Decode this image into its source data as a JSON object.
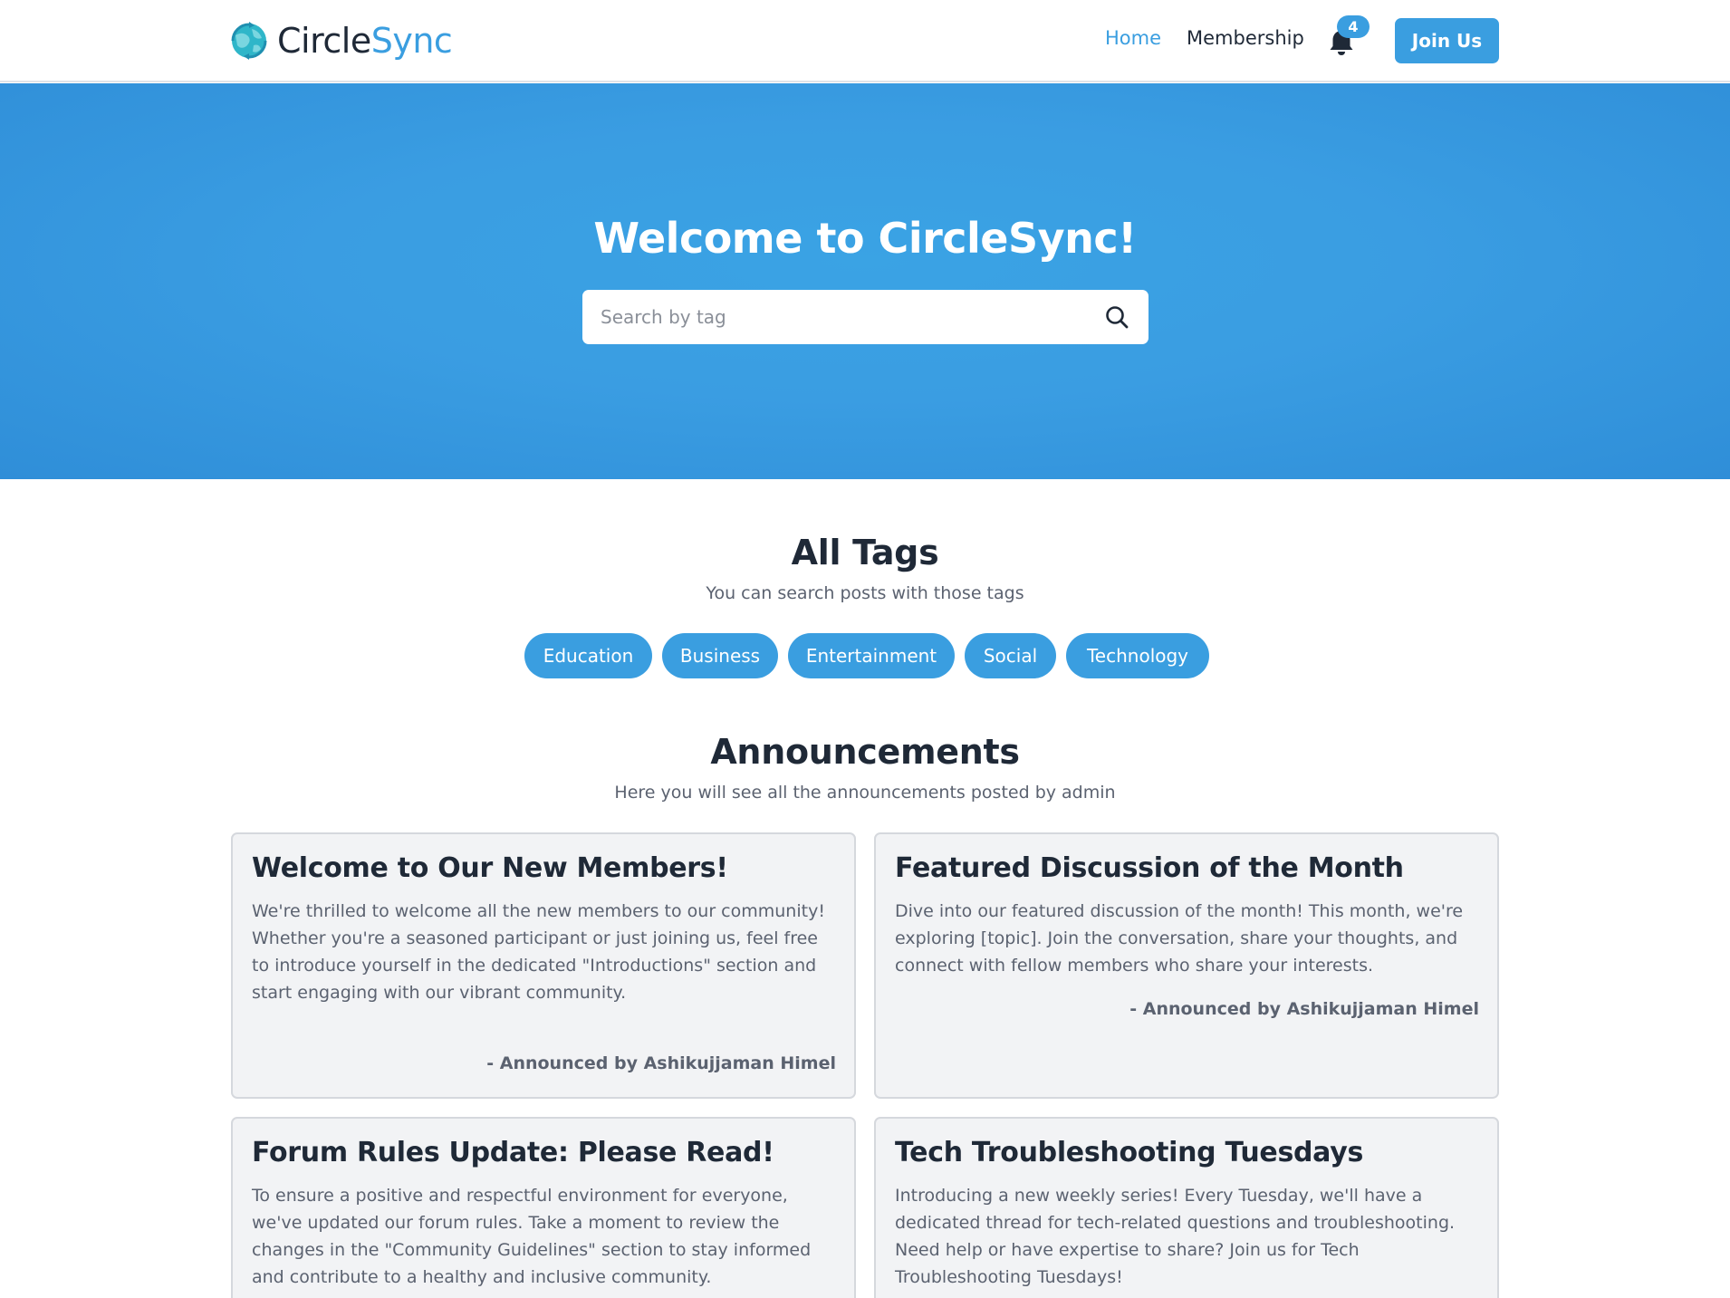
{
  "brand": {
    "name_part1": "Circle",
    "name_part2": "Sync",
    "accent_color": "#3a9ee0"
  },
  "nav": {
    "home_label": "Home",
    "membership_label": "Membership",
    "notification_count": "4",
    "join_label": "Join Us"
  },
  "hero": {
    "title": "Welcome to CircleSync!",
    "search_placeholder": "Search by tag",
    "search_value": ""
  },
  "tags_section": {
    "title": "All Tags",
    "subtitle": "You can search posts with those tags",
    "tags": [
      "Education",
      "Business",
      "Entertainment",
      "Social",
      "Technology"
    ]
  },
  "announcements_section": {
    "title": "Announcements",
    "subtitle": "Here you will see all the announcements posted by admin",
    "items": [
      {
        "title": "Welcome to Our New Members!",
        "body": "We're thrilled to welcome all the new members to our community! Whether you're a seasoned participant or just joining us, feel free to introduce yourself in the dedicated \"Introductions\" section and start engaging with our vibrant community.",
        "author": "- Announced by Ashikujjaman Himel"
      },
      {
        "title": "Featured Discussion of the Month",
        "body": "Dive into our featured discussion of the month! This month, we're exploring [topic]. Join the conversation, share your thoughts, and connect with fellow members who share your interests.",
        "author": "- Announced by Ashikujjaman Himel"
      },
      {
        "title": "Forum Rules Update: Please Read!",
        "body": "To ensure a positive and respectful environment for everyone, we've updated our forum rules. Take a moment to review the changes in the \"Community Guidelines\" section to stay informed and contribute to a healthy and inclusive community."
      },
      {
        "title": "Tech Troubleshooting Tuesdays",
        "body": "Introducing a new weekly series! Every Tuesday, we'll have a dedicated thread for tech-related questions and troubleshooting. Need help or have expertise to share? Join us for Tech Troubleshooting Tuesdays!"
      }
    ]
  }
}
